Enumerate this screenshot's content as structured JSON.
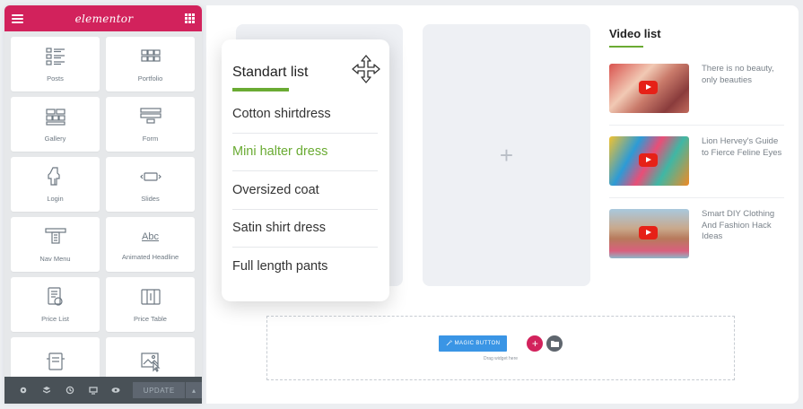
{
  "panel": {
    "logo": "elementor",
    "widgets": [
      {
        "label": "Posts",
        "icon": "posts-icon"
      },
      {
        "label": "Portfolio",
        "icon": "portfolio-icon"
      },
      {
        "label": "Gallery",
        "icon": "gallery-icon"
      },
      {
        "label": "Form",
        "icon": "form-icon"
      },
      {
        "label": "Login",
        "icon": "login-icon"
      },
      {
        "label": "Slides",
        "icon": "slides-icon"
      },
      {
        "label": "Nav Menu",
        "icon": "nav-menu-icon"
      },
      {
        "label": "Animated Headline",
        "icon": "animated-headline-icon",
        "glyph": "Abc"
      },
      {
        "label": "Price List",
        "icon": "price-list-icon"
      },
      {
        "label": "Price Table",
        "icon": "price-table-icon"
      },
      {
        "label": "",
        "icon": "flip-box-icon"
      },
      {
        "label": "",
        "icon": "image-icon"
      }
    ],
    "footer": {
      "update_label": "UPDATE",
      "icons": [
        "settings-icon",
        "navigator-icon",
        "history-icon",
        "responsive-icon",
        "preview-icon"
      ]
    }
  },
  "canvas": {
    "plus_glyph": "+",
    "standart_list": {
      "title": "Standart list",
      "items": [
        "Cotton shirtdress",
        "Mini halter dress",
        "Oversized coat",
        "Satin shirt dress",
        "Full length pants"
      ],
      "active_index": 1
    },
    "video_list": {
      "title": "Video list",
      "items": [
        {
          "text": "There is no beauty, only beauties"
        },
        {
          "text": "Lion Hervey's Guide to Fierce Feline Eyes"
        },
        {
          "text": "Smart DIY Clothing And Fashion Hack Ideas"
        }
      ]
    },
    "dropzone": {
      "magic_button": "MAGIC BUTTON",
      "add_glyph": "+",
      "hint": "Drag widget here"
    }
  },
  "colors": {
    "brand": "#d2225c",
    "accent_green": "#6aab33",
    "magic_blue": "#3a95e5",
    "youtube_red": "#e62117"
  }
}
